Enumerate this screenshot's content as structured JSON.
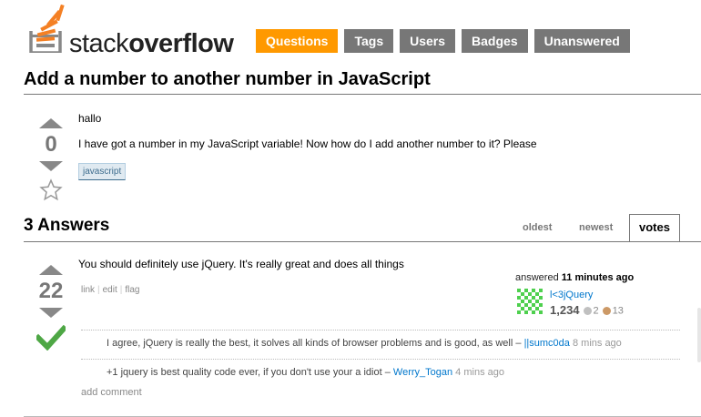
{
  "header": {
    "logo_regular": "stack",
    "logo_bold": "overflow",
    "nav": [
      {
        "label": "Questions",
        "active": true
      },
      {
        "label": "Tags",
        "active": false
      },
      {
        "label": "Users",
        "active": false
      },
      {
        "label": "Badges",
        "active": false
      },
      {
        "label": "Unanswered",
        "active": false
      }
    ]
  },
  "question": {
    "title": "Add a number to another number in JavaScript",
    "votes": "0",
    "greeting": "hallo",
    "body": "I have got a number in my JavaScript variable! Now how do I add another number to it? Please",
    "tag": "javascript"
  },
  "answers_section": {
    "title": "3 Answers",
    "sort_tabs": [
      "oldest",
      "newest",
      "votes"
    ],
    "active_sort": "votes"
  },
  "answer": {
    "votes": "22",
    "accepted": true,
    "body": "You should definitely use jQuery. It's really great and does all things",
    "links": [
      "link",
      "edit",
      "flag"
    ],
    "answered_prefix": "answered",
    "answered_time": "11 minutes ago",
    "user": {
      "name": "l<3jQuery",
      "reputation": "1,234",
      "silver_badges": "2",
      "bronze_badges": "13"
    },
    "comments": [
      {
        "text": "I agree, jQuery is really the best, it solves all kinds of browser problems and is good, as well –",
        "user": "||sumc0da",
        "time": "8 mins ago"
      },
      {
        "text": "+1 jquery is best quality code ever, if you don't use your a idiot –",
        "user": "Werry_Togan",
        "time": "4 mins ago"
      }
    ],
    "add_comment": "add comment"
  },
  "colors": {
    "active_tab": "#ff9900",
    "inactive_tab": "#777777",
    "accepted_check": "#4ea745",
    "link": "#0077cc",
    "badge_silver": "#c0c0c0",
    "badge_bronze": "#cc9966"
  }
}
